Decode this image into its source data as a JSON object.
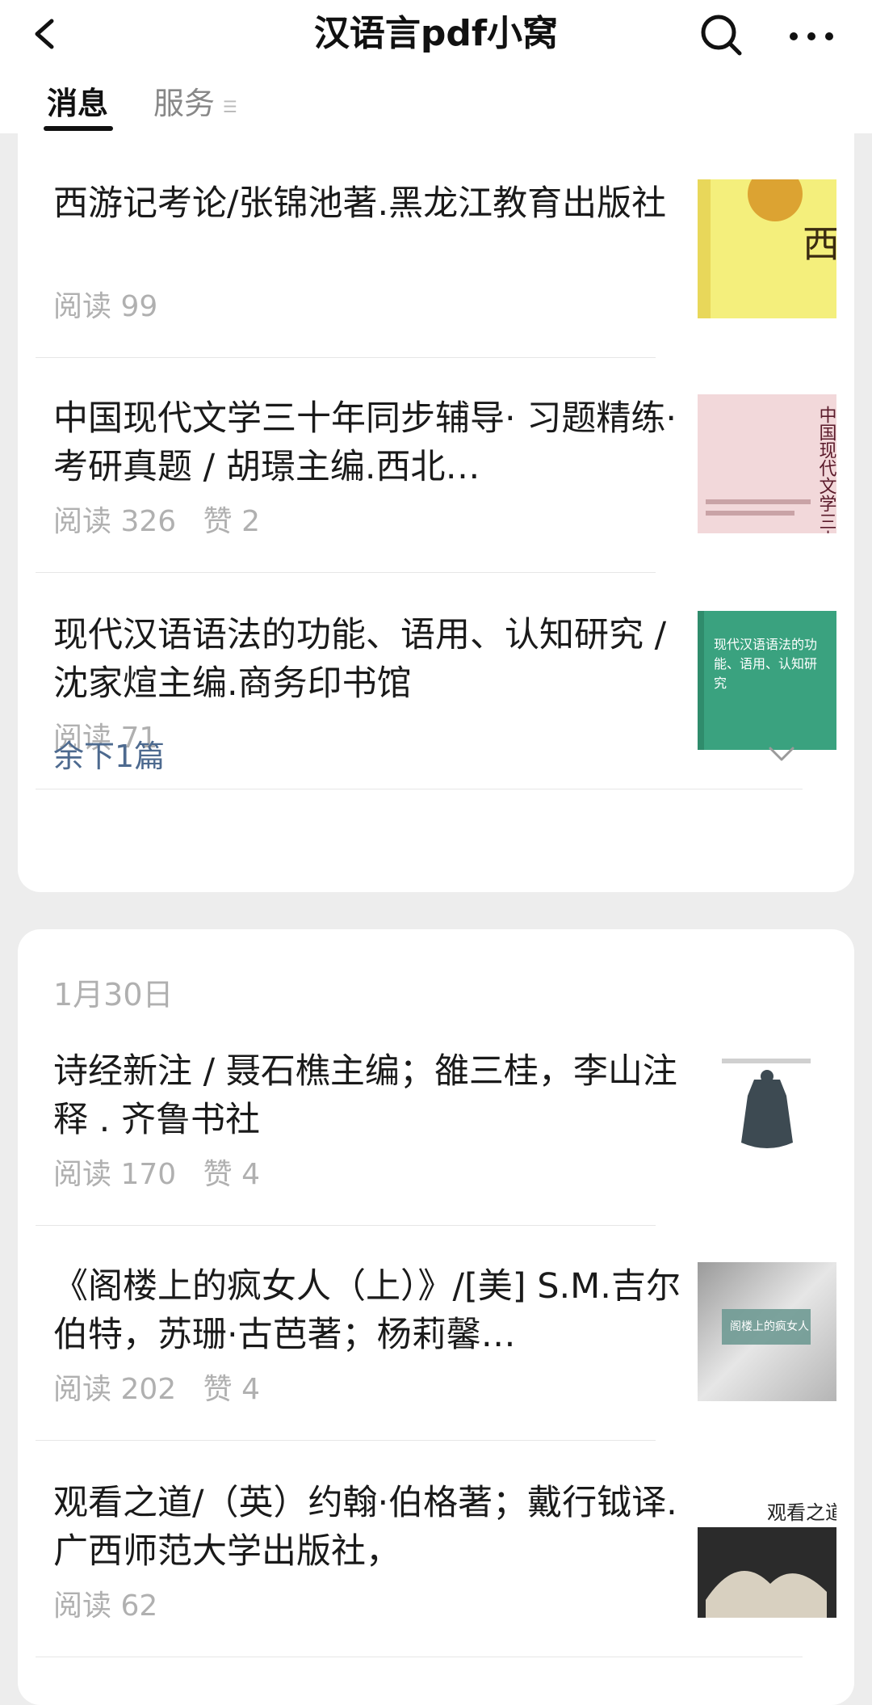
{
  "header": {
    "title": "汉语言pdf小窝"
  },
  "tabs": {
    "messages": "消息",
    "services": "服务"
  },
  "group1": {
    "articles": [
      {
        "title": "西游记考论/张锦池著.黑龙江教育出版社",
        "reads": "阅读 99",
        "likes": ""
      },
      {
        "title": "中国现代文学三十年同步辅导· 习题精练· 考研真题 / 胡璟主编.西北…",
        "reads": "阅读 326",
        "likes": "赞 2"
      },
      {
        "title": "现代汉语语法的功能、语用、认知研究 / 沈家煊主编.商务印书馆",
        "reads": "阅读 71",
        "likes": ""
      }
    ],
    "remaining": "余下1篇",
    "thumbs": {
      "t1_text": "西遊記考論",
      "t2_text": "中国现代文学三十年",
      "t3_text": "现代汉语语法的功能、语用、认知研究"
    }
  },
  "group2": {
    "date": "1月30日",
    "articles": [
      {
        "title": "诗经新注 / 聂石樵主编；雒三桂，李山注释 . 齐鲁书社",
        "reads": "阅读 170",
        "likes": "赞 4"
      },
      {
        "title": "《阁楼上的疯女人（上）》/[美] S.M.吉尔伯特，苏珊·古芭著；杨莉馨…",
        "reads": "阅读 202",
        "likes": "赞 4"
      },
      {
        "title": "观看之道/（英）约翰·伯格著；戴行钺译.广西师范大学出版社，",
        "reads": "阅读 62",
        "likes": ""
      }
    ],
    "thumbs": {
      "t5_text": "阁楼上的疯女人",
      "t6_text": "观看之道"
    }
  }
}
